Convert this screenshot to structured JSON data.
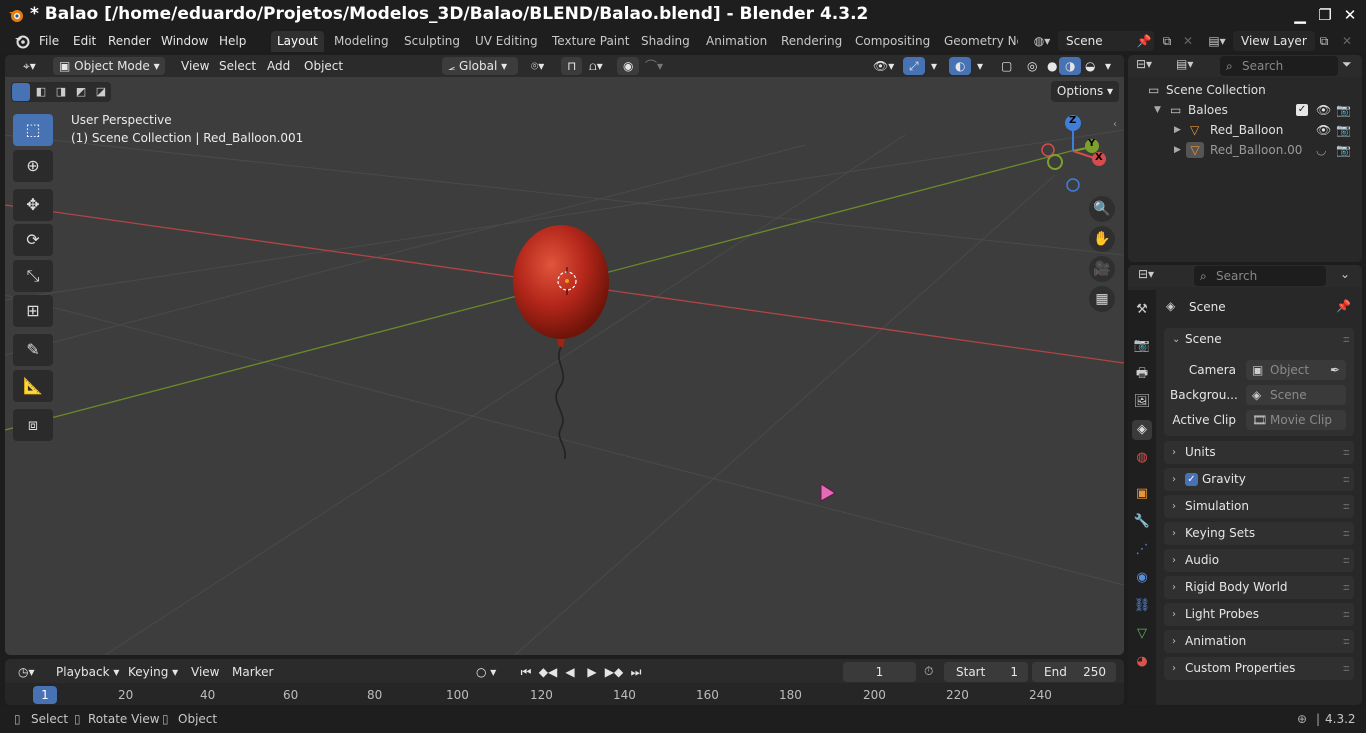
{
  "window": {
    "title": "* Balao [/home/eduardo/Projetos/Modelos_3D/Balao/BLEND/Balao.blend] - Blender 4.3.2",
    "minimize": "▁",
    "maximize": "❐",
    "close": "✕"
  },
  "menu": {
    "items": [
      "File",
      "Edit",
      "Render",
      "Window",
      "Help"
    ]
  },
  "workspaces": {
    "tabs": [
      "Layout",
      "Modeling",
      "Sculpting",
      "UV Editing",
      "Texture Paint",
      "Shading",
      "Animation",
      "Rendering",
      "Compositing",
      "Geometry Noc"
    ],
    "active": "Layout"
  },
  "scene_selector": {
    "value": "Scene"
  },
  "view_layer_selector": {
    "value": "View Layer"
  },
  "viewport_header": {
    "mode": "Object Mode",
    "menus": [
      "View",
      "Select",
      "Add",
      "Object"
    ],
    "orientation": "Global",
    "options_label": "Options"
  },
  "viewport": {
    "perspective_label": "User Perspective",
    "collection_label": "(1) Scene Collection | Red_Balloon.001",
    "gizmo": {
      "z": "Z",
      "y": "Y",
      "x": "X"
    },
    "colors": {
      "x_axis": "#d64b4b",
      "y_axis": "#7ca12b",
      "z_axis": "#3f7fd9",
      "balloon": "#b3261a",
      "cursor": "#e66ab7"
    }
  },
  "outliner": {
    "search_placeholder": "Search",
    "root": "Scene Collection",
    "collection": "Baloes",
    "objects": [
      "Red_Balloon",
      "Red_Balloon.00"
    ]
  },
  "properties": {
    "search_placeholder": "Search",
    "context": "Scene",
    "scene_panel": {
      "title": "Scene",
      "camera_label": "Camera",
      "camera_value": "Object",
      "background_label": "Backgrou...",
      "background_value": "Scene",
      "clip_label": "Active Clip",
      "clip_value": "Movie Clip"
    },
    "panels": [
      "Units",
      "Gravity",
      "Simulation",
      "Keying Sets",
      "Audio",
      "Rigid Body World",
      "Light Probes",
      "Animation",
      "Custom Properties"
    ],
    "gravity_checked": true
  },
  "timeline": {
    "menus": [
      "Playback",
      "Keying",
      "View",
      "Marker"
    ],
    "current_frame": "1",
    "start_label": "Start",
    "start_value": "1",
    "end_label": "End",
    "end_value": "250",
    "ticks": [
      "1",
      "20",
      "40",
      "60",
      "80",
      "100",
      "120",
      "140",
      "160",
      "180",
      "200",
      "220",
      "240"
    ]
  },
  "statusbar": {
    "select": "Select",
    "rotate": "Rotate View",
    "object": "Object",
    "version": "4.3.2"
  }
}
